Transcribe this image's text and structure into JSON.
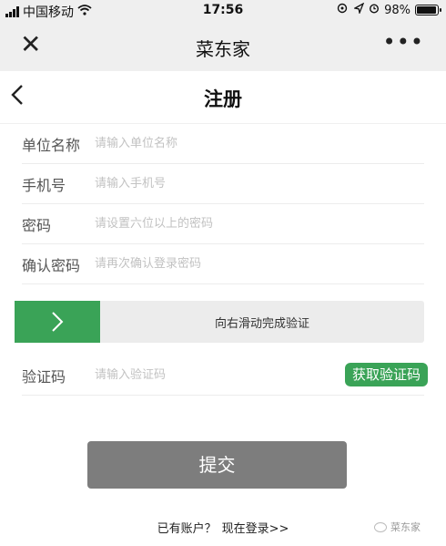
{
  "status": {
    "carrier": "中国移动",
    "time": "17:56",
    "battery": "98%",
    "battery_level": 0.98
  },
  "appbar": {
    "title": "菜东家"
  },
  "navbar": {
    "title": "注册"
  },
  "form": {
    "company": {
      "label": "单位名称",
      "placeholder": "请输入单位名称"
    },
    "phone": {
      "label": "手机号",
      "placeholder": "请输入手机号"
    },
    "password": {
      "label": "密码",
      "placeholder": "请设置六位以上的密码"
    },
    "confirm": {
      "label": "确认密码",
      "placeholder": "请再次确认登录密码"
    },
    "slider_hint": "向右滑动完成验证",
    "code": {
      "label": "验证码",
      "placeholder": "请输入验证码",
      "button": "获取验证码"
    },
    "submit": "提交"
  },
  "footer": {
    "prompt": "已有账户？",
    "login_link": "现在登录>>"
  },
  "watermark": "菜东家",
  "colors": {
    "accent": "#3aa357",
    "submit_bg": "#7d7d7d"
  },
  "icons": {
    "slider": "chevron-right-icon",
    "back": "back-arrow-icon",
    "close": "close-icon",
    "more": "more-dots-icon"
  }
}
